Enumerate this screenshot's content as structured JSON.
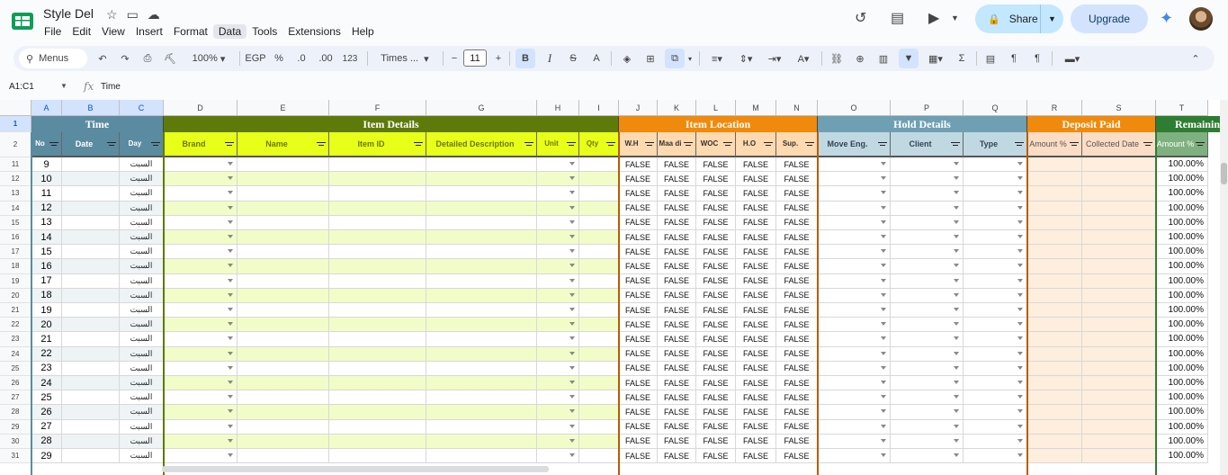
{
  "app": {
    "title": "Style Del",
    "menus": [
      "File",
      "Edit",
      "View",
      "Insert",
      "Format",
      "Data",
      "Tools",
      "Extensions",
      "Help"
    ],
    "active_menu": "Data",
    "share_label": "Share",
    "upgrade_label": "Upgrade"
  },
  "toolbar": {
    "menus_label": "Menus",
    "zoom": "100%",
    "currency": "EGP",
    "percent": "%",
    "dec_decrease": ".0",
    "dec_increase": ".00",
    "number_format": "123",
    "font": "Times ...",
    "font_size": "11",
    "bold": "B",
    "italic": "I",
    "strike": "S",
    "text_color": "A"
  },
  "formula_bar": {
    "name_box": "A1:C1",
    "fx": "fx",
    "value": "Time"
  },
  "columns": [
    "A",
    "B",
    "C",
    "D",
    "E",
    "F",
    "G",
    "H",
    "I",
    "J",
    "K",
    "L",
    "M",
    "N",
    "O",
    "P",
    "Q",
    "R",
    "S",
    "T"
  ],
  "selected_columns": [
    "A",
    "B",
    "C"
  ],
  "groups": [
    {
      "label": "Time",
      "color": "#5b8ba0"
    },
    {
      "label": "Item Details",
      "color": "#5e7a0b"
    },
    {
      "label": "Item Location",
      "color": "#f08a0c"
    },
    {
      "label": "Hold Details",
      "color": "#6f9fb3"
    },
    {
      "label": "Deposit Paid",
      "color": "#f08a0c"
    },
    {
      "label": "Remaining",
      "color": "#2e7d32"
    }
  ],
  "field_headers": [
    "No",
    "Date",
    "Day",
    "Brand",
    "Name",
    "Item ID",
    "Detailed Description",
    "Unit",
    "Qty",
    "W.H",
    "Maa di",
    "WOC",
    "H.O",
    "Sup.",
    "Move Eng.",
    "Client",
    "Type",
    "Amount %",
    "Collected Date",
    "Amount %"
  ],
  "row_numbers": [
    "1",
    "2",
    "11",
    "12",
    "13",
    "14",
    "15",
    "16",
    "17",
    "18",
    "19",
    "20",
    "21",
    "22",
    "23",
    "24",
    "25",
    "26",
    "27",
    "28",
    "29",
    "30",
    "31"
  ],
  "rows": [
    {
      "no": "9",
      "day": "السبت",
      "pct": "100.00%"
    },
    {
      "no": "10",
      "day": "السبت",
      "pct": "100.00%"
    },
    {
      "no": "11",
      "day": "السبت",
      "pct": "100.00%"
    },
    {
      "no": "12",
      "day": "السبت",
      "pct": "100.00%"
    },
    {
      "no": "13",
      "day": "السبت",
      "pct": "100.00%"
    },
    {
      "no": "14",
      "day": "السبت",
      "pct": "100.00%"
    },
    {
      "no": "15",
      "day": "السبت",
      "pct": "100.00%"
    },
    {
      "no": "16",
      "day": "السبت",
      "pct": "100.00%"
    },
    {
      "no": "17",
      "day": "السبت",
      "pct": "100.00%"
    },
    {
      "no": "18",
      "day": "السبت",
      "pct": "100.00%"
    },
    {
      "no": "19",
      "day": "السبت",
      "pct": "100.00%"
    },
    {
      "no": "20",
      "day": "السبت",
      "pct": "100.00%"
    },
    {
      "no": "21",
      "day": "السبت",
      "pct": "100.00%"
    },
    {
      "no": "22",
      "day": "السبت",
      "pct": "100.00%"
    },
    {
      "no": "23",
      "day": "السبت",
      "pct": "100.00%"
    },
    {
      "no": "24",
      "day": "السبت",
      "pct": "100.00%"
    },
    {
      "no": "25",
      "day": "السبت",
      "pct": "100.00%"
    },
    {
      "no": "26",
      "day": "السبت",
      "pct": "100.00%"
    },
    {
      "no": "27",
      "day": "السبت",
      "pct": "100.00%"
    },
    {
      "no": "28",
      "day": "السبت",
      "pct": "100.00%"
    },
    {
      "no": "29",
      "day": "السبت",
      "pct": "100.00%"
    }
  ],
  "bool_value": "FALSE"
}
